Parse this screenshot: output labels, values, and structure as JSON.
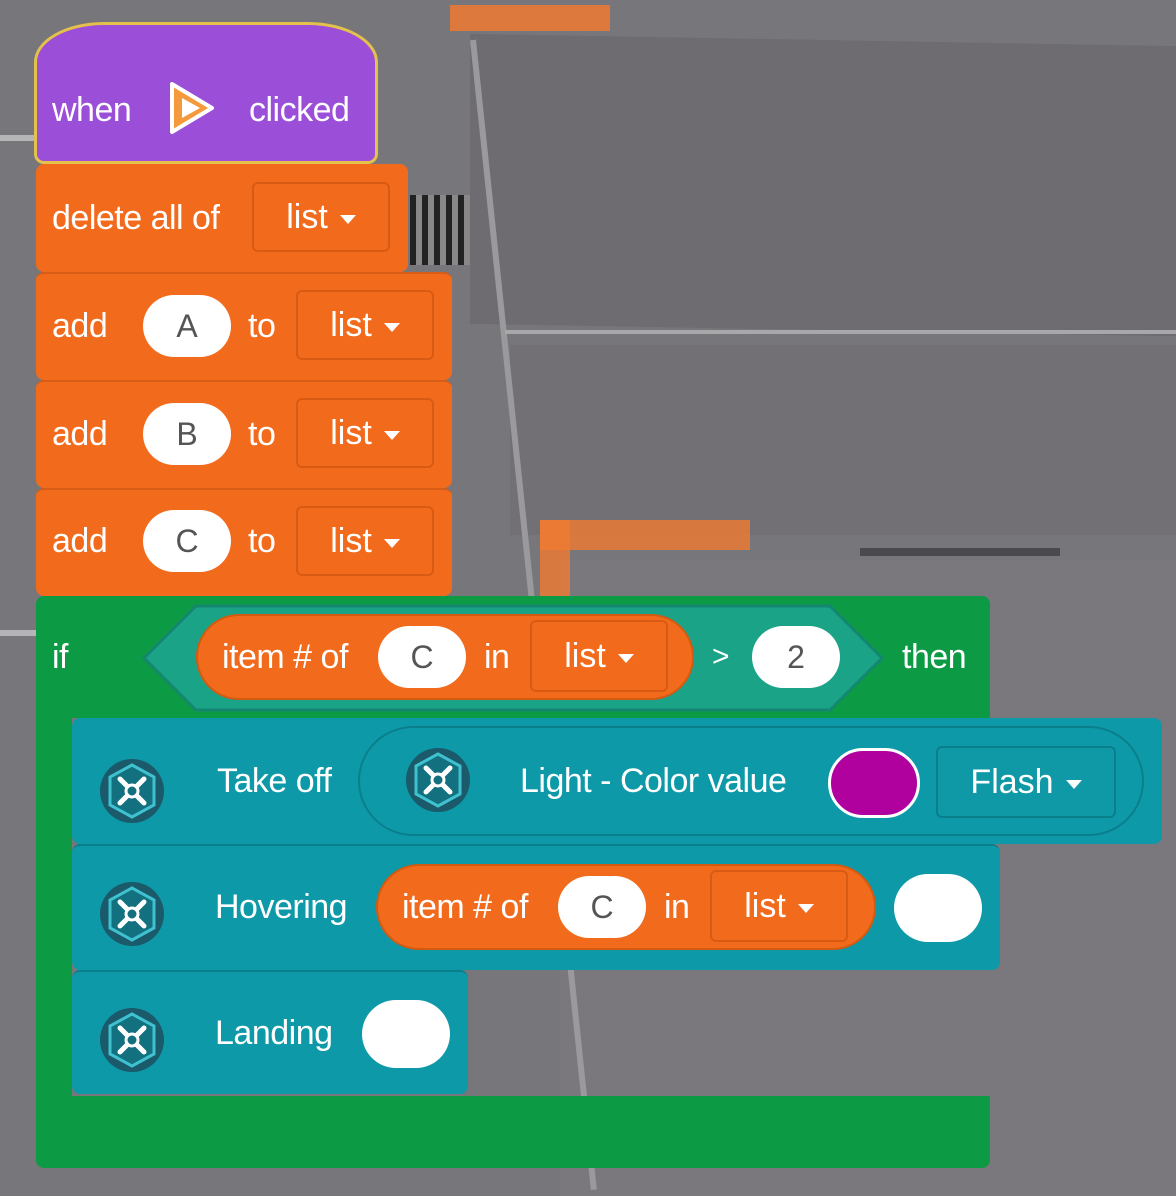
{
  "hat_block": {
    "when_label": "when",
    "clicked_label": "clicked",
    "flag_icon": "play-flag-icon"
  },
  "delete_block": {
    "label": "delete all of",
    "list_value": "list"
  },
  "add_blocks": [
    {
      "add_label": "add",
      "value": "A",
      "to_label": "to",
      "list_value": "list"
    },
    {
      "add_label": "add",
      "value": "B",
      "to_label": "to",
      "list_value": "list"
    },
    {
      "add_label": "add",
      "value": "C",
      "to_label": "to",
      "list_value": "list"
    }
  ],
  "if_block": {
    "if_label": "if",
    "then_label": "then",
    "condition": {
      "item_label": "item # of",
      "item_value": "C",
      "in_label": "in",
      "list_value": "list",
      "operator": ">",
      "compare_value": "2"
    }
  },
  "drone_blocks": {
    "takeoff": {
      "label": "Take off",
      "inner_label": "Light - Color value",
      "color": "#b0009e",
      "mode_value": "Flash"
    },
    "hovering": {
      "label": "Hovering",
      "item_label": "item # of",
      "item_value": "C",
      "in_label": "in",
      "list_value": "list",
      "extra_value": ""
    },
    "landing": {
      "label": "Landing",
      "value": ""
    }
  },
  "colors": {
    "events": "#9b4fd9",
    "list": "#f26b1d",
    "control": "#0d9a45",
    "operator": "#1aa386",
    "drone": "#0e99a8"
  }
}
